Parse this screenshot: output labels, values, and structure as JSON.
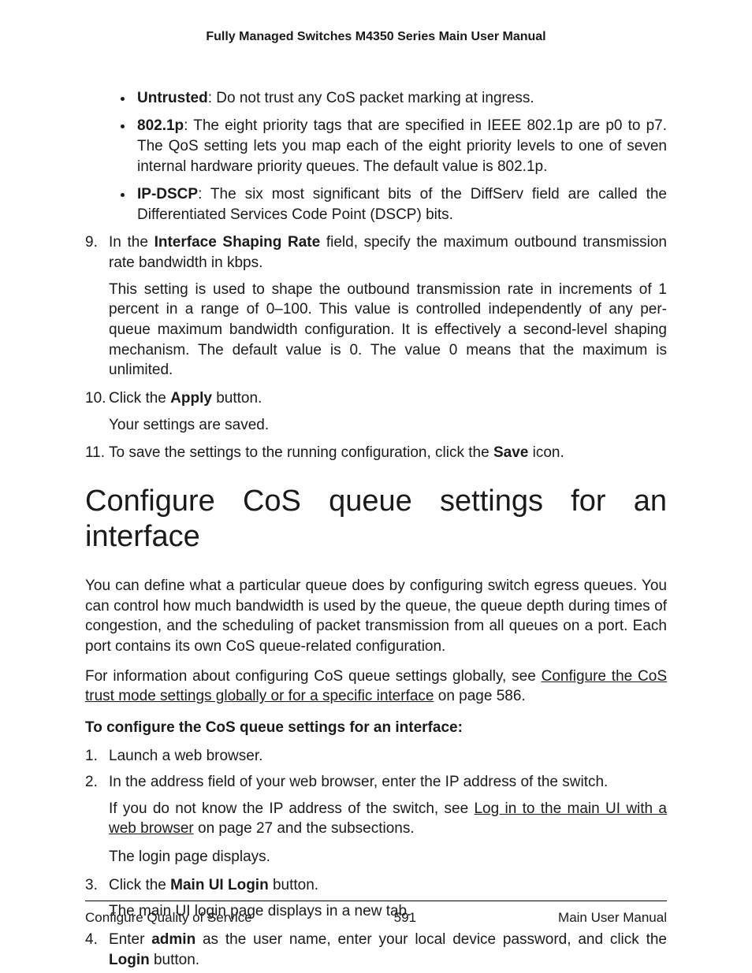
{
  "header": "Fully Managed Switches M4350 Series Main User Manual",
  "bullets": [
    {
      "term": "Untrusted",
      "desc": ": Do not trust any CoS packet marking at ingress."
    },
    {
      "term": "802.1p",
      "desc": ": The eight priority tags that are specified in IEEE 802.1p are p0 to p7. The QoS setting lets you map each of the eight priority levels to one of seven internal hardware priority queues. The default value is 802.1p."
    },
    {
      "term": "IP-DSCP",
      "desc": ": The six most significant bits of the DiffServ field are called the Differentiated Services Code Point (DSCP) bits."
    }
  ],
  "steps": {
    "s9": {
      "pre": "In the ",
      "bold": "Interface Shaping Rate",
      "post": " field, specify the maximum outbound transmission rate bandwidth in kbps.",
      "note": "This setting is used to shape the outbound transmission rate in increments of 1 percent in a range of 0–100. This value is controlled independently of any per-queue maximum bandwidth configuration. It is effectively a second-level shaping mechanism. The default value is 0. The value 0 means that the maximum is unlimited."
    },
    "s10": {
      "pre": "Click the ",
      "bold": "Apply",
      "post": " button.",
      "note": "Your settings are saved."
    },
    "s11": {
      "pre": "To save the settings to the running configuration, click the ",
      "bold": "Save",
      "post": " icon."
    }
  },
  "h1": "Configure CoS queue settings for an interface",
  "intro1": "You can define what a particular queue does by configuring switch egress queues. You can control how much bandwidth is used by the queue, the queue depth during times of congestion, and the scheduling of packet transmission from all queues on a port. Each port contains its own CoS queue-related configuration.",
  "intro2": {
    "pre": "For information about configuring CoS queue settings globally, see ",
    "link": "Configure the CoS trust mode settings globally or for a specific interface",
    "post": " on page 586."
  },
  "procHead": "To configure the CoS queue settings for an interface:",
  "steps2": {
    "s1": "Launch a web browser.",
    "s2": {
      "main": "In the address field of your web browser, enter the IP address of the switch.",
      "note_pre": "If you do not know the IP address of the switch, see ",
      "note_link": "Log in to the main UI with a web browser",
      "note_post": " on page 27 and the subsections.",
      "note2": "The login page displays."
    },
    "s3": {
      "pre": "Click the ",
      "bold": "Main UI Login",
      "post": " button.",
      "note": "The main UI login page displays in a new tab."
    },
    "s4": {
      "pre": "Enter ",
      "b1": "admin",
      "mid": " as the user name, enter your local device password, and click the ",
      "b2": "Login",
      "post": " button."
    }
  },
  "footer": {
    "left": "Configure Quality of Service",
    "center": "591",
    "right": "Main User Manual"
  }
}
